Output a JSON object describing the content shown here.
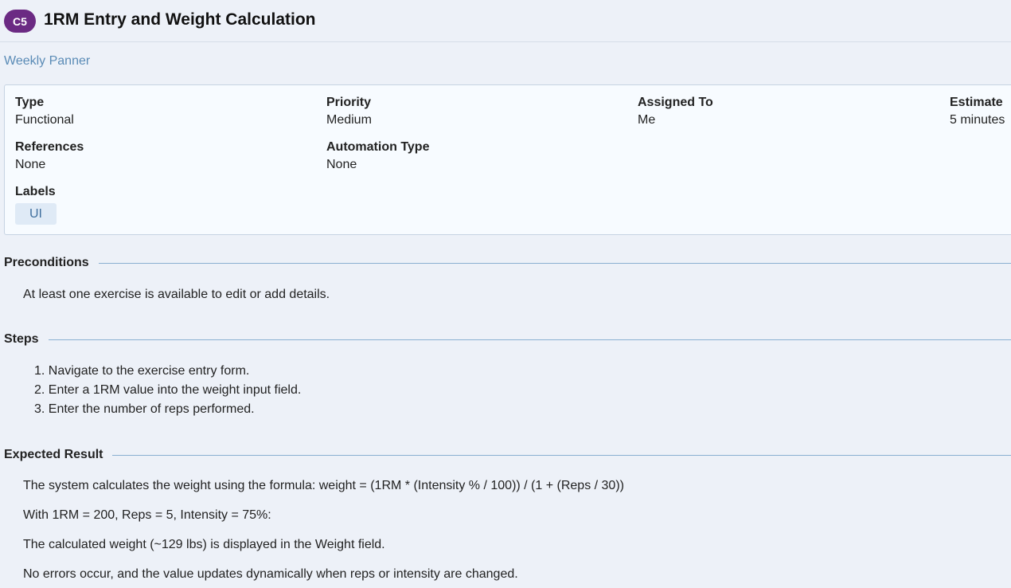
{
  "header": {
    "badge": "C5",
    "title": "1RM Entry and Weight Calculation"
  },
  "breadcrumb": "Weekly Panner",
  "details": {
    "type_label": "Type",
    "type_value": "Functional",
    "priority_label": "Priority",
    "priority_value": "Medium",
    "assigned_label": "Assigned To",
    "assigned_value": "Me",
    "estimate_label": "Estimate",
    "estimate_value": "5 minutes",
    "references_label": "References",
    "references_value": "None",
    "automation_label": "Automation Type",
    "automation_value": "None",
    "labels_label": "Labels",
    "labels": [
      "UI"
    ]
  },
  "preconditions": {
    "heading": "Preconditions",
    "text": "At least one exercise is available to edit or add details."
  },
  "steps": {
    "heading": "Steps",
    "items": [
      "1. Navigate to the exercise entry form.",
      "2. Enter a 1RM value into the weight input field.",
      "3. Enter the number of reps performed."
    ]
  },
  "expected": {
    "heading": "Expected Result",
    "lines": [
      "The system calculates the weight using the formula: weight = (1RM * (Intensity % / 100)) / (1 + (Reps / 30))",
      "With 1RM = 200, Reps = 5, Intensity = 75%:",
      "The calculated weight (~129 lbs) is displayed in the Weight field.",
      "No errors occur, and the value updates dynamically when reps or intensity are changed."
    ]
  },
  "colors": {
    "badge": "#6b2a83",
    "link": "#5a8bb6",
    "background": "#edf1f8",
    "card": "#f7fbff",
    "tag": "#dfeaf6"
  }
}
